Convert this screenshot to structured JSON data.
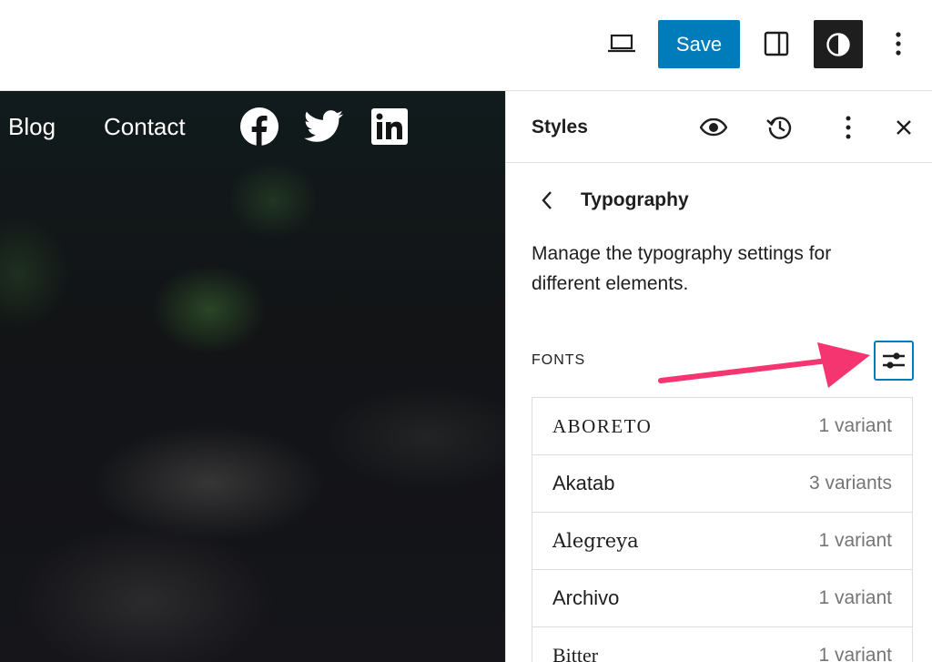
{
  "toolbar": {
    "save_label": "Save",
    "icons": [
      "desktop-preview-icon",
      "sidebar-toggle-icon",
      "styles-contrast-icon",
      "more-options-icon"
    ]
  },
  "canvas": {
    "nav": {
      "blog": "Blog",
      "contact": "Contact"
    },
    "social_icons": [
      "facebook-icon",
      "twitter-icon",
      "linkedin-icon"
    ]
  },
  "panel": {
    "title": "Styles",
    "section_title": "Typography",
    "description": "Manage the typography settings for different elements.",
    "fonts_heading": "FONTS",
    "fonts": [
      {
        "name": "ABORETO",
        "variants": "1 variant"
      },
      {
        "name": "Akatab",
        "variants": "3 variants"
      },
      {
        "name": "Alegreya",
        "variants": "1 variant"
      },
      {
        "name": "Archivo",
        "variants": "1 variant"
      },
      {
        "name": "Bitter",
        "variants": "1 variant"
      }
    ]
  },
  "colors": {
    "accent": "#007cba",
    "annotation_arrow": "#f5356f",
    "dark_button": "#1e1e1e"
  }
}
